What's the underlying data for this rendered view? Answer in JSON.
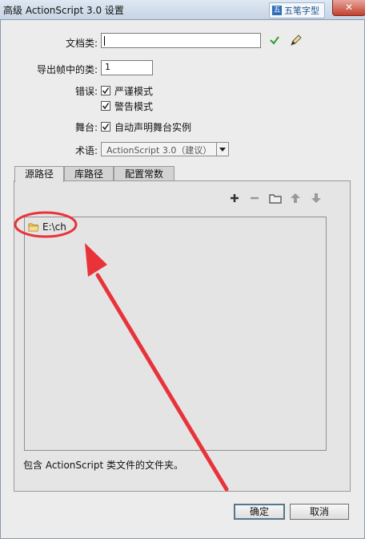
{
  "window": {
    "title": "高级 ActionScript 3.0 设置",
    "close_glyph": "✕"
  },
  "ime": {
    "glyph": "五",
    "label": "五笔字型"
  },
  "form": {
    "doc_class_label": "文档类:",
    "doc_class_value": "",
    "export_frame_label": "导出帧中的类:",
    "export_frame_value": "1",
    "errors_label": "错误:",
    "strict_mode": "严谨模式",
    "warnings_mode": "警告模式",
    "stage_label": "舞台:",
    "auto_declare": "自动声明舞台实例",
    "dialect_label": "术语:",
    "dialect_value": "ActionScript 3.0（建议）"
  },
  "tabs": [
    {
      "label": "源路径",
      "active": true
    },
    {
      "label": "库路径",
      "active": false
    },
    {
      "label": "配置常数",
      "active": false
    }
  ],
  "toolbar": [
    "add-icon",
    "remove-icon",
    "browse-folder-icon",
    "move-up-icon",
    "move-down-icon"
  ],
  "paths": [
    {
      "label": "E:\\ch"
    }
  ],
  "description": "包含 ActionScript 类文件的文件夹。",
  "buttons": {
    "ok": "确定",
    "cancel": "取消"
  },
  "colors": {
    "annotation": "#e8333a",
    "check": "#2e9c2e",
    "titlebar": "#cbd8e8"
  }
}
